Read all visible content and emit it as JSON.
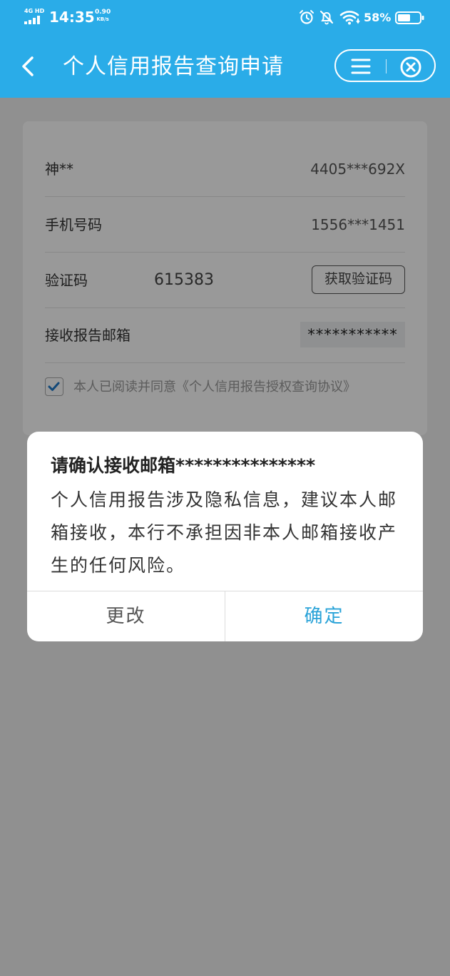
{
  "status_bar": {
    "network": "4G HD",
    "time": "14:35",
    "speed_value": "0.90",
    "speed_unit": "KB/s",
    "battery": "58%",
    "icons": [
      "signal-icon",
      "alarm-icon",
      "bell-muted-icon",
      "wifi-icon",
      "battery-icon"
    ]
  },
  "header": {
    "title": "个人信用报告查询申请",
    "back_icon": "chevron-left-icon",
    "menu_icon": "menu-icon",
    "close_icon": "close-circle-icon"
  },
  "form": {
    "name_label": "神**",
    "id_value": "4405***692X",
    "phone_label": "手机号码",
    "phone_value": "1556***1451",
    "code_label": "验证码",
    "code_value": "615383",
    "get_code_button": "获取验证码",
    "email_label": "接收报告邮箱",
    "email_value": "***********",
    "agree_checked": true,
    "agree_text": "本人已阅读并同意《个人信用报告授权查询协议》"
  },
  "dialog": {
    "title": "请确认接收邮箱***************",
    "body": "个人信用报告涉及隐私信息，建议本人邮箱接收，本行不承担因非本人邮箱接收产生的任何风险。",
    "cancel_label": "更改",
    "confirm_label": "确定"
  },
  "colors": {
    "brand": "#2aace8",
    "confirm_text": "#2aa3d8",
    "checkbox_check": "#1f78c8"
  }
}
